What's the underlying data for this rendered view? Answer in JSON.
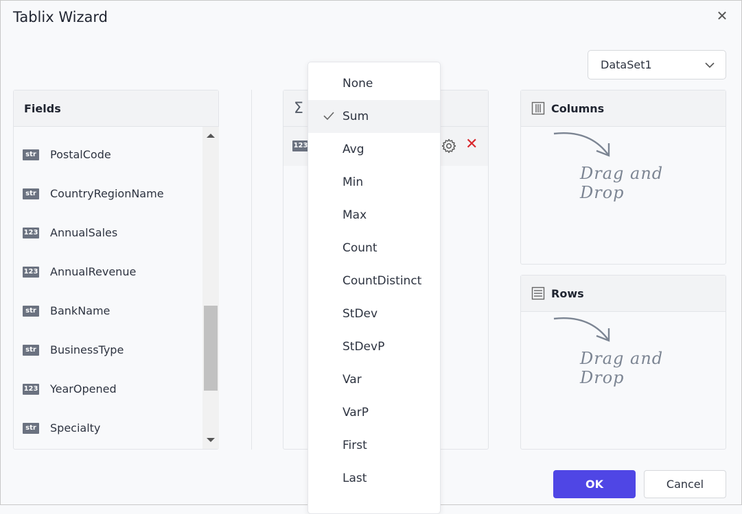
{
  "dialog": {
    "title": "Tablix Wizard",
    "close_icon": "close-icon"
  },
  "dataset": {
    "selected": "DataSet1"
  },
  "fields_panel": {
    "title": "Fields",
    "items": [
      {
        "type": "str",
        "name": "PostalCode"
      },
      {
        "type": "str",
        "name": "CountryRegionName"
      },
      {
        "type": "123",
        "name": "AnnualSales"
      },
      {
        "type": "123",
        "name": "AnnualRevenue"
      },
      {
        "type": "str",
        "name": "BankName"
      },
      {
        "type": "str",
        "name": "BusinessType"
      },
      {
        "type": "123",
        "name": "YearOpened"
      },
      {
        "type": "str",
        "name": "Specialty"
      }
    ]
  },
  "values_panel": {
    "header_icon": "Σ",
    "row": {
      "type": "123"
    },
    "remove_glyph": "✕"
  },
  "columns_panel": {
    "title": "Columns",
    "placeholder": "Drag and Drop"
  },
  "rows_panel": {
    "title": "Rows",
    "placeholder": "Drag and Drop"
  },
  "aggregate_menu": {
    "selected": "Sum",
    "items": [
      "None",
      "Sum",
      "Avg",
      "Min",
      "Max",
      "Count",
      "CountDistinct",
      "StDev",
      "StDevP",
      "Var",
      "VarP",
      "First",
      "Last"
    ]
  },
  "footer": {
    "ok_label": "OK",
    "cancel_label": "Cancel"
  },
  "colors": {
    "accent": "#4f46e5",
    "remove": "#d9262c",
    "badge": "#6b7280"
  }
}
